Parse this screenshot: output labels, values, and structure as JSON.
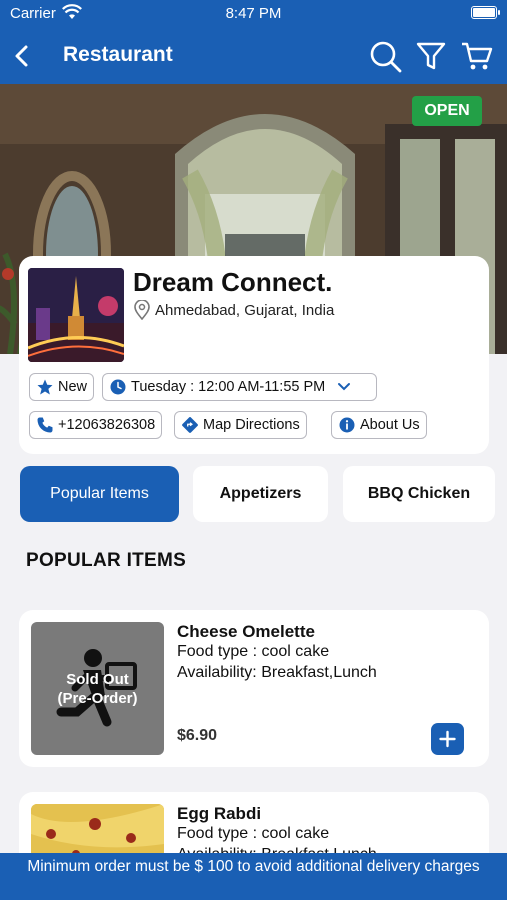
{
  "status_bar": {
    "carrier": "Carrier",
    "time": "8:47 PM"
  },
  "nav": {
    "title": "Restaurant"
  },
  "hero": {
    "open_label": "OPEN"
  },
  "restaurant": {
    "name": "Dream Connect.",
    "address": "Ahmedabad, Gujarat, India",
    "badge_new": "New",
    "hours": "Tuesday : 12:00 AM-11:55 PM",
    "phone": "+12063826308",
    "map_label": "Map Directions",
    "about_label": "About Us"
  },
  "tabs": [
    {
      "label": "Popular Items",
      "active": true
    },
    {
      "label": "Appetizers",
      "active": false
    },
    {
      "label": "BBQ Chicken",
      "active": false
    }
  ],
  "section_title": "POPULAR ITEMS",
  "items": [
    {
      "name": "Cheese Omelette",
      "food_type": "Food type : cool cake",
      "availability": "Availability: Breakfast,Lunch",
      "price": "$6.90",
      "sold_out_line1": "Sold Out",
      "sold_out_line2": "(Pre-Order)"
    },
    {
      "name": "Egg Rabdi",
      "food_type": "Food type : cool cake",
      "availability": "Availability: Breakfast,Lunch"
    }
  ],
  "footer": {
    "message": "Minimum order must be $ 100 to avoid additional delivery charges"
  },
  "colors": {
    "primary": "#1a5fb4",
    "open_green": "#23a047",
    "background": "#f2f2f5"
  }
}
